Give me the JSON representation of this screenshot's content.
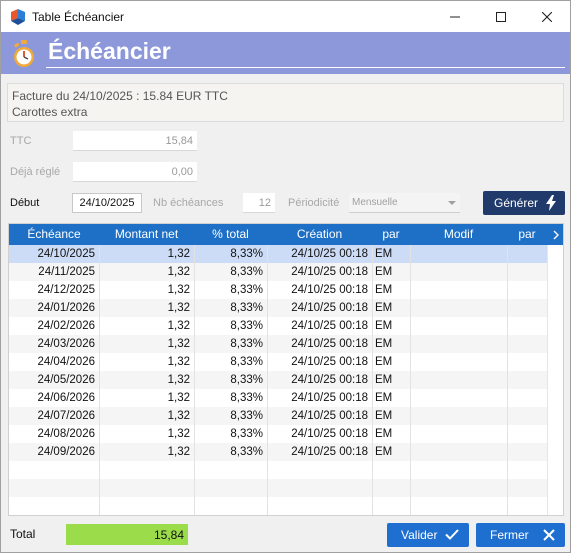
{
  "window": {
    "title": "Table Échéancier",
    "minimize_icon": "minimize-icon",
    "maximize_icon": "maximize-icon",
    "close_icon": "close-icon"
  },
  "banner": {
    "title": "Échéancier",
    "icon": "stopwatch-icon",
    "background_color": "#8c98d9"
  },
  "invoice": {
    "line1": "Facture du 24/10/2025 : 15.84 EUR TTC",
    "line2": "Carottes extra"
  },
  "form": {
    "ttc_label": "TTC",
    "ttc_value": "15,84",
    "deja_regle_label": "Déjà réglé",
    "deja_regle_value": "0,00",
    "debut_label": "Début",
    "debut_value": "24/10/2025",
    "nb_echeances_label": "Nb échéances",
    "nb_echeances_value": "12",
    "periodicite_label": "Périodicité",
    "periodicite_value": "Mensuelle",
    "generer_label": "Générer",
    "generer_icon": "lightning-icon"
  },
  "table": {
    "columns": [
      "Échéance",
      "Montant net",
      "% total",
      "Création",
      "par",
      "Modif",
      "par"
    ],
    "header_color": "#1e6fc6",
    "selected_row": 0,
    "rows": [
      [
        "24/10/2025",
        "1,32",
        "8,33%",
        "24/10/25 00:18",
        "EM",
        "",
        ""
      ],
      [
        "24/11/2025",
        "1,32",
        "8,33%",
        "24/10/25 00:18",
        "EM",
        "",
        ""
      ],
      [
        "24/12/2025",
        "1,32",
        "8,33%",
        "24/10/25 00:18",
        "EM",
        "",
        ""
      ],
      [
        "24/01/2026",
        "1,32",
        "8,33%",
        "24/10/25 00:18",
        "EM",
        "",
        ""
      ],
      [
        "24/02/2026",
        "1,32",
        "8,33%",
        "24/10/25 00:18",
        "EM",
        "",
        ""
      ],
      [
        "24/03/2026",
        "1,32",
        "8,33%",
        "24/10/25 00:18",
        "EM",
        "",
        ""
      ],
      [
        "24/04/2026",
        "1,32",
        "8,33%",
        "24/10/25 00:18",
        "EM",
        "",
        ""
      ],
      [
        "24/05/2026",
        "1,32",
        "8,33%",
        "24/10/25 00:18",
        "EM",
        "",
        ""
      ],
      [
        "24/06/2026",
        "1,32",
        "8,33%",
        "24/10/25 00:18",
        "EM",
        "",
        ""
      ],
      [
        "24/07/2026",
        "1,32",
        "8,33%",
        "24/10/25 00:18",
        "EM",
        "",
        ""
      ],
      [
        "24/08/2026",
        "1,32",
        "8,33%",
        "24/10/25 00:18",
        "EM",
        "",
        ""
      ],
      [
        "24/09/2026",
        "1,32",
        "8,33%",
        "24/10/25 00:18",
        "EM",
        "",
        ""
      ]
    ]
  },
  "footer": {
    "total_label": "Total",
    "total_value": "15,84",
    "total_color": "#9bdc4a",
    "valider_label": "Valider",
    "valider_icon": "checkmark-icon",
    "fermer_label": "Fermer",
    "fermer_icon": "close-icon",
    "button_color": "#1f6fd1"
  }
}
